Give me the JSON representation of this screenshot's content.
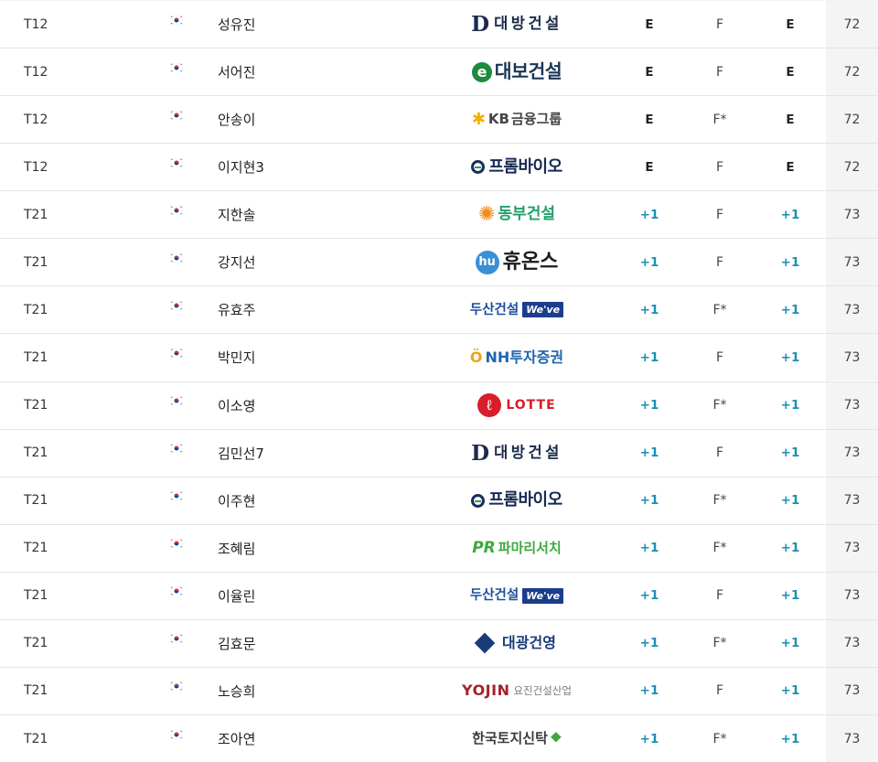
{
  "colors": {
    "even": "#222222",
    "over": "#1a8fb3",
    "flag_red": "#cd2e3a",
    "flag_blue": "#0047a0"
  },
  "rows": [
    {
      "rank": "T12",
      "flag": "korea-flag-icon",
      "name": "성유진",
      "sponsor": {
        "style": "daebang",
        "mark": "D",
        "text": "대방건설"
      },
      "today": "E",
      "thru": "F",
      "total": "E",
      "strokes": "72"
    },
    {
      "rank": "T12",
      "flag": "korea-flag-icon",
      "name": "서어진",
      "sponsor": {
        "style": "daebo",
        "mark": "e",
        "text": "대보건설"
      },
      "today": "E",
      "thru": "F",
      "total": "E",
      "strokes": "72"
    },
    {
      "rank": "T12",
      "flag": "korea-flag-icon",
      "name": "안송이",
      "sponsor": {
        "style": "kb",
        "mark": "✱",
        "kb": "KB",
        "text": "금융그룹"
      },
      "today": "E",
      "thru": "F*",
      "total": "E",
      "strokes": "72"
    },
    {
      "rank": "T12",
      "flag": "korea-flag-icon",
      "name": "이지현3",
      "sponsor": {
        "style": "prom",
        "text": "프롬바이오"
      },
      "today": "E",
      "thru": "F",
      "total": "E",
      "strokes": "72"
    },
    {
      "rank": "T21",
      "flag": "korea-flag-icon",
      "name": "지한솔",
      "sponsor": {
        "style": "dongbu",
        "mark": "✺",
        "text": "동부건설"
      },
      "today": "+1",
      "thru": "F",
      "total": "+1",
      "strokes": "73"
    },
    {
      "rank": "T21",
      "flag": "korea-flag-icon",
      "name": "강지선",
      "sponsor": {
        "style": "huons",
        "mark": "hu",
        "text": "휴온스"
      },
      "today": "+1",
      "thru": "F",
      "total": "+1",
      "strokes": "73"
    },
    {
      "rank": "T21",
      "flag": "korea-flag-icon",
      "name": "유효주",
      "sponsor": {
        "style": "doosan",
        "text": "두산건설",
        "mark": "We've"
      },
      "today": "+1",
      "thru": "F*",
      "total": "+1",
      "strokes": "73"
    },
    {
      "rank": "T21",
      "flag": "korea-flag-icon",
      "name": "박민지",
      "sponsor": {
        "style": "nh",
        "mark": "Ö",
        "text": "NH투자증권"
      },
      "today": "+1",
      "thru": "F",
      "total": "+1",
      "strokes": "73"
    },
    {
      "rank": "T21",
      "flag": "korea-flag-icon",
      "name": "이소영",
      "sponsor": {
        "style": "lotte",
        "mark": "ℓ",
        "text": "LOTTE"
      },
      "today": "+1",
      "thru": "F*",
      "total": "+1",
      "strokes": "73"
    },
    {
      "rank": "T21",
      "flag": "korea-flag-icon",
      "name": "김민선7",
      "sponsor": {
        "style": "daebang",
        "mark": "D",
        "text": "대방건설"
      },
      "today": "+1",
      "thru": "F",
      "total": "+1",
      "strokes": "73"
    },
    {
      "rank": "T21",
      "flag": "korea-flag-icon",
      "name": "이주현",
      "sponsor": {
        "style": "prom",
        "text": "프롬바이오"
      },
      "today": "+1",
      "thru": "F*",
      "total": "+1",
      "strokes": "73"
    },
    {
      "rank": "T21",
      "flag": "korea-flag-icon",
      "name": "조혜림",
      "sponsor": {
        "style": "pharma",
        "mark": "PR",
        "text": "파마리서치"
      },
      "today": "+1",
      "thru": "F*",
      "total": "+1",
      "strokes": "73"
    },
    {
      "rank": "T21",
      "flag": "korea-flag-icon",
      "name": "이율린",
      "sponsor": {
        "style": "doosan",
        "text": "두산건설",
        "mark": "We've"
      },
      "today": "+1",
      "thru": "F",
      "total": "+1",
      "strokes": "73"
    },
    {
      "rank": "T21",
      "flag": "korea-flag-icon",
      "name": "김효문",
      "sponsor": {
        "style": "daegwang",
        "text": "대광건영"
      },
      "today": "+1",
      "thru": "F*",
      "total": "+1",
      "strokes": "73"
    },
    {
      "rank": "T21",
      "flag": "korea-flag-icon",
      "name": "노승희",
      "sponsor": {
        "style": "yojin",
        "text": "YOJIN",
        "sub": "요진건설산업"
      },
      "today": "+1",
      "thru": "F",
      "total": "+1",
      "strokes": "73"
    },
    {
      "rank": "T21",
      "flag": "korea-flag-icon",
      "name": "조아연",
      "sponsor": {
        "style": "koreatrust",
        "text": "한국토지신탁",
        "mark": "⯁"
      },
      "today": "+1",
      "thru": "F*",
      "total": "+1",
      "strokes": "73"
    }
  ]
}
